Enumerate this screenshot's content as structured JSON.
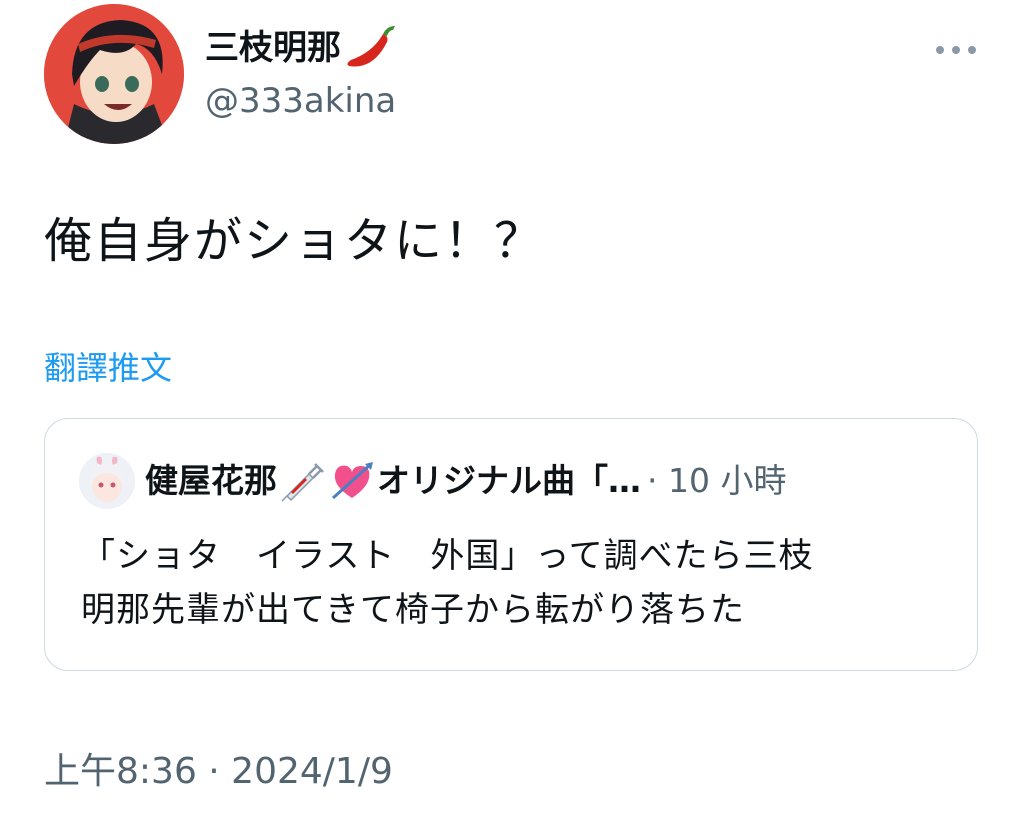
{
  "author": {
    "display_name": "三枝明那",
    "name_emoji": "hot-pepper-icon",
    "handle": "@333akina"
  },
  "tweet": {
    "text": "俺自身がショタに！？",
    "translate_label": "翻譯推文",
    "timestamp": "上午8:36 · 2024/1/9"
  },
  "quote": {
    "display_name": "健屋花那",
    "name_emojis": [
      "syringe-icon",
      "heart-with-arrow-icon"
    ],
    "name_suffix": "オリジナル曲「…",
    "time": "· 10 小時",
    "text_lines": [
      "「ショタ　イラスト　外国」って調べたら三枝",
      "明那先輩が出てきて椅子から転がり落ちた"
    ]
  },
  "colors": {
    "link": "#1d9bf0",
    "secondary_text": "#536471",
    "border": "#cfd9de",
    "avatar_bg": "#e2483c"
  }
}
